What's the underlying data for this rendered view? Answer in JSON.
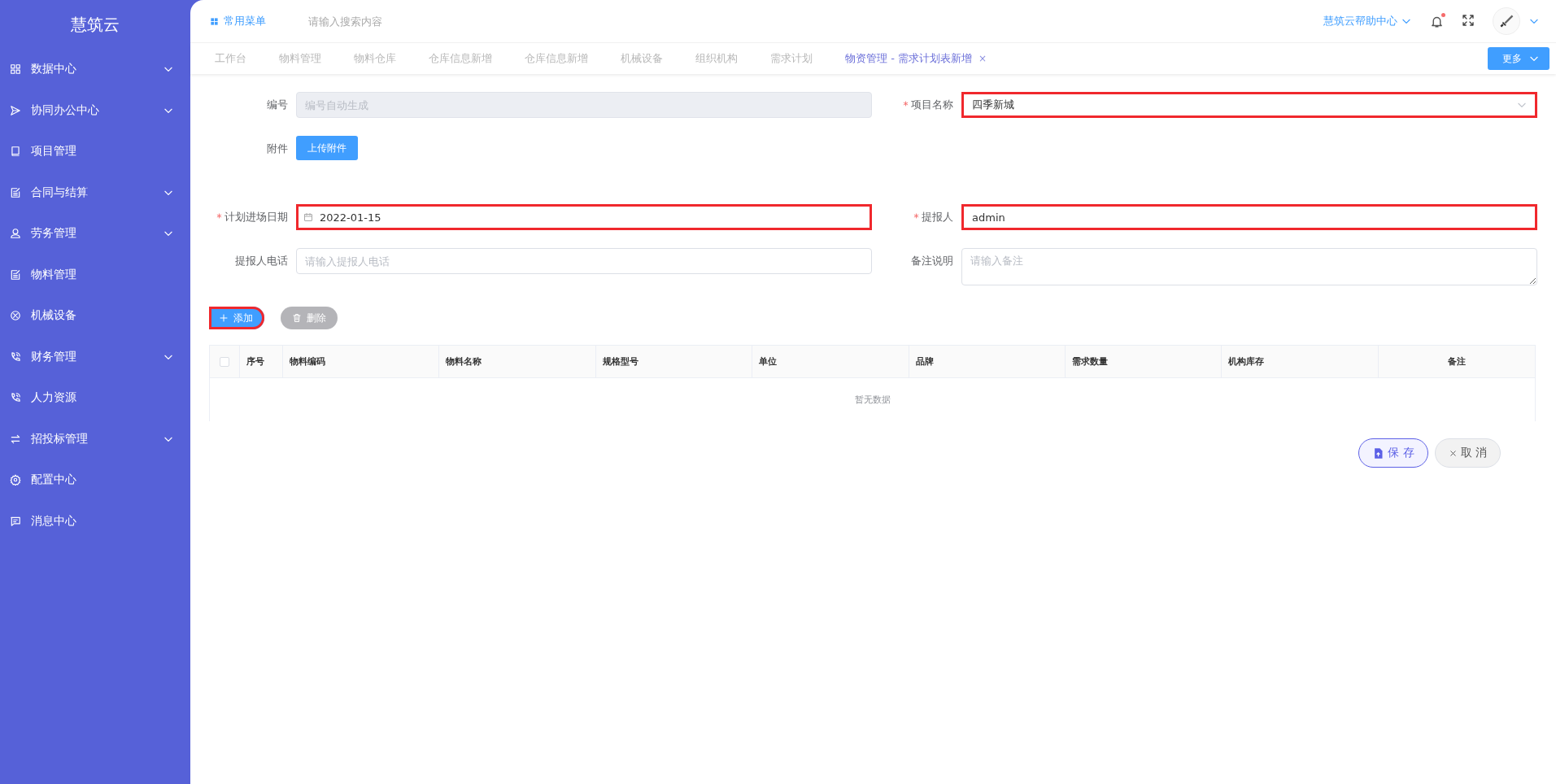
{
  "sidebar": {
    "title": "慧筑云",
    "items": [
      {
        "label": "数据中心",
        "expandable": true
      },
      {
        "label": "协同办公中心",
        "expandable": true
      },
      {
        "label": "项目管理",
        "expandable": false
      },
      {
        "label": "合同与结算",
        "expandable": true
      },
      {
        "label": "劳务管理",
        "expandable": true
      },
      {
        "label": "物料管理",
        "expandable": false
      },
      {
        "label": "机械设备",
        "expandable": false
      },
      {
        "label": "财务管理",
        "expandable": true
      },
      {
        "label": "人力资源",
        "expandable": false
      },
      {
        "label": "招投标管理",
        "expandable": true
      },
      {
        "label": "配置中心",
        "expandable": false
      },
      {
        "label": "消息中心",
        "expandable": false
      }
    ]
  },
  "topbar": {
    "menu_link": "常用菜单",
    "search": {
      "placeholder": "请输入搜索内容"
    },
    "help_link": "慧筑云帮助中心",
    "notification_dot": true
  },
  "tabs": [
    {
      "label": "工作台",
      "selected": false
    },
    {
      "label": "物料管理",
      "selected": false
    },
    {
      "label": "物料仓库",
      "selected": false
    },
    {
      "label": "仓库信息新增",
      "selected": false
    },
    {
      "label": "仓库信息新增",
      "selected": false
    },
    {
      "label": "机械设备",
      "selected": false
    },
    {
      "label": "组织机构",
      "selected": false
    },
    {
      "label": "需求计划",
      "selected": false
    },
    {
      "label": "物资管理 - 需求计划表新增",
      "selected": true,
      "close": "×"
    }
  ],
  "more_button": "更多",
  "form": {
    "rows": [
      {
        "left": {
          "kind": "text",
          "label": "编号",
          "required": false,
          "placeholder": "编号自动生成",
          "disabled": true,
          "highlighted": false
        },
        "right": {
          "kind": "select",
          "label": "项目名称",
          "required": true,
          "value": "四季新城",
          "disabled": false,
          "highlighted": true
        }
      },
      {
        "left": {
          "kind": "upload",
          "label": "附件",
          "required": false,
          "button": "上传附件"
        }
      },
      {
        "left": {
          "kind": "date",
          "label": "计划进场日期",
          "required": true,
          "value": "2022-01-15",
          "disabled": false,
          "highlighted": true
        },
        "right": {
          "kind": "text",
          "label": "提报人",
          "required": true,
          "value": "admin",
          "disabled": false,
          "highlighted": true
        }
      },
      {
        "left": {
          "kind": "text",
          "label": "提报人电话",
          "required": false,
          "placeholder": "请输入提报人电话",
          "disabled": false,
          "highlighted": false
        },
        "right": {
          "kind": "textarea",
          "label": "备注说明",
          "required": false,
          "placeholder": "请输入备注",
          "disabled": false,
          "highlighted": false
        }
      }
    ]
  },
  "table_actions": [
    {
      "kind": "add",
      "label": "添加",
      "disabled": false,
      "highlighted": true
    },
    {
      "kind": "delete",
      "label": "删除",
      "disabled": true,
      "highlighted": false
    }
  ],
  "table": {
    "select_all_checked": false,
    "columns": [
      "序号",
      "物料编码",
      "物料名称",
      "规格型号",
      "单位",
      "品牌",
      "需求数量",
      "机构库存",
      "备注"
    ],
    "empty_text": "暂无数据"
  },
  "form_actions": [
    {
      "kind": "save",
      "label": "保 存"
    },
    {
      "kind": "cancel",
      "label": "取 消"
    }
  ]
}
